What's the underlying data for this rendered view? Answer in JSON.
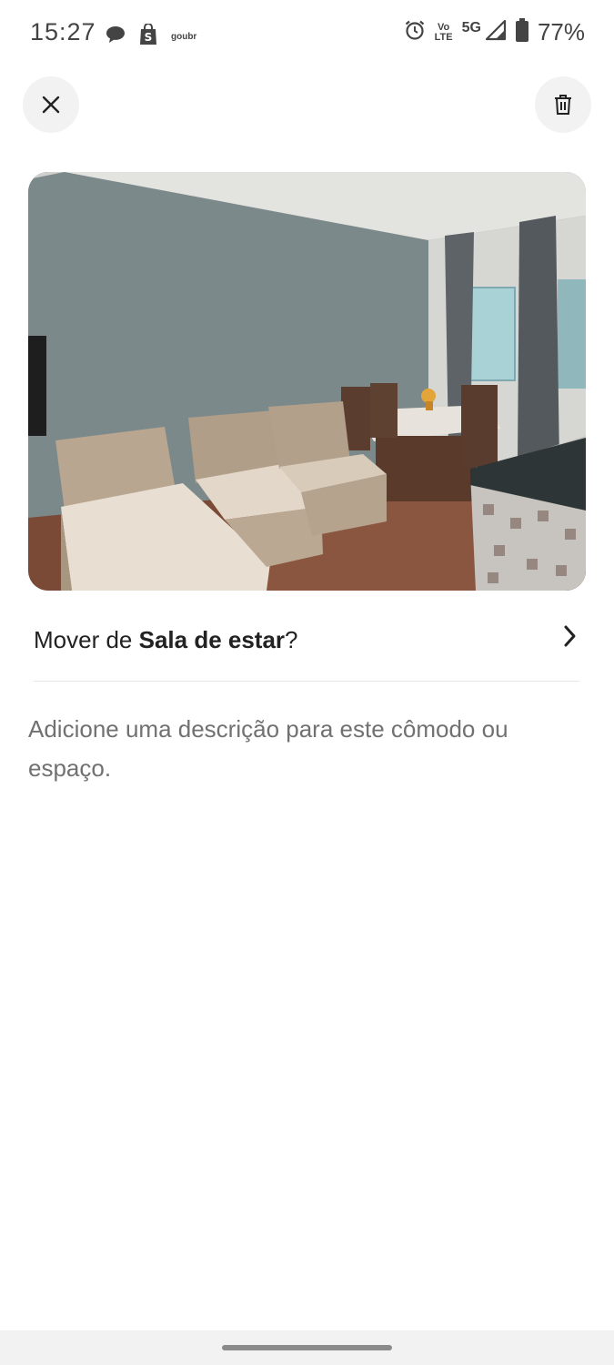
{
  "status_bar": {
    "time": "15:27",
    "notification_icons": [
      "chat-bubble-icon",
      "shopping-bag-icon",
      "goubr-logo"
    ],
    "small_logo_text": "goubr",
    "volte_top": "Vo",
    "volte_bottom": "LTE",
    "network": "5G",
    "battery": "77%"
  },
  "header": {
    "close_icon": "close-icon",
    "delete_icon": "trash-icon"
  },
  "photo": {
    "subject": "living-room-photo"
  },
  "move_row": {
    "prefix": "Mover de ",
    "room": "Sala de estar",
    "suffix": "?"
  },
  "description": {
    "placeholder": "Adicione uma descrição para este cômodo ou espaço."
  },
  "colors": {
    "text_primary": "#222222",
    "text_secondary": "#717171",
    "button_bg": "#f2f2f2",
    "divider": "#e4e4e4"
  }
}
